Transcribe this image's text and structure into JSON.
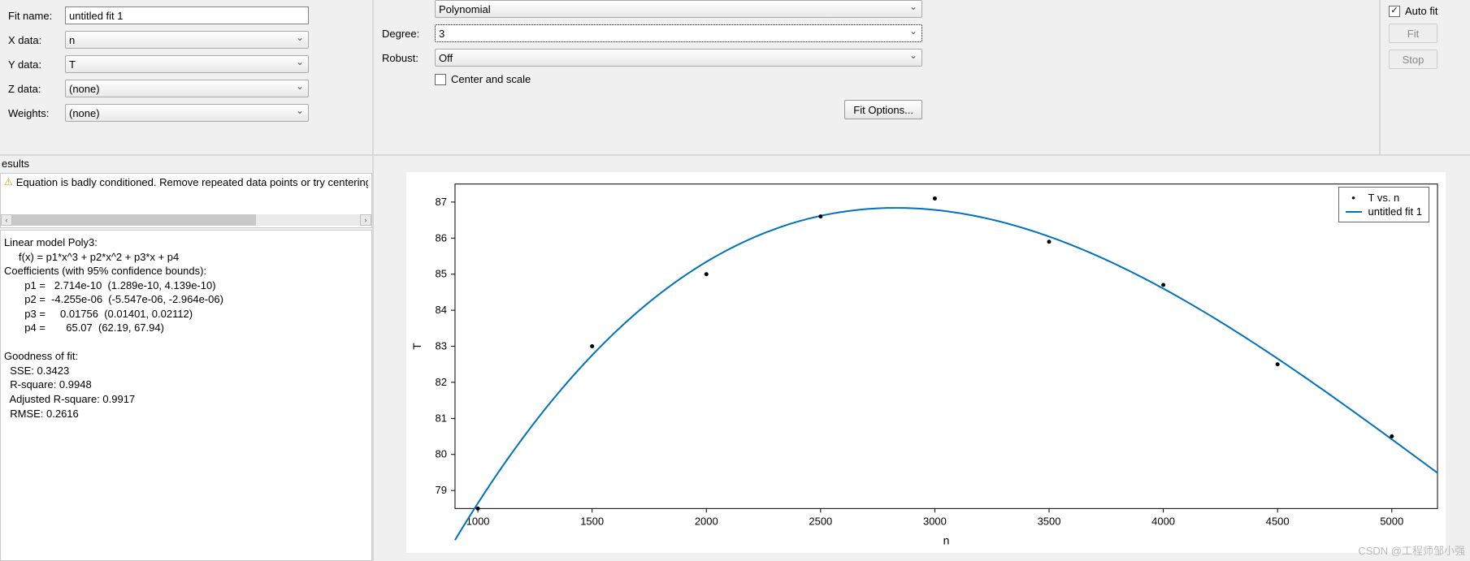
{
  "left": {
    "fit_name_label": "Fit name:",
    "fit_name_value": "untitled fit 1",
    "xdata_label": "X data:",
    "xdata_value": "n",
    "ydata_label": "Y data:",
    "ydata_value": "T",
    "zdata_label": "Z data:",
    "zdata_value": "(none)",
    "weights_label": "Weights:",
    "weights_value": "(none)"
  },
  "center": {
    "type_value": "Polynomial",
    "degree_label": "Degree:",
    "degree_value": "3",
    "robust_label": "Robust:",
    "robust_value": "Off",
    "center_scale_label": "Center and scale",
    "fit_options_label": "Fit Options..."
  },
  "right": {
    "autofit_label": "Auto fit",
    "fit_label": "Fit",
    "stop_label": "Stop"
  },
  "results": {
    "header": "esults",
    "warning": "Equation is badly conditioned. Remove repeated data points or try centering and scaling.",
    "model_text": "Linear model Poly3:\n     f(x) = p1*x^3 + p2*x^2 + p3*x + p4\nCoefficients (with 95% confidence bounds):\n       p1 =   2.714e-10  (1.289e-10, 4.139e-10)\n       p2 =  -4.255e-06  (-5.547e-06, -2.964e-06)\n       p3 =     0.01756  (0.01401, 0.02112)\n       p4 =       65.07  (62.19, 67.94)\n\nGoodness of fit:\n  SSE: 0.3423\n  R-square: 0.9948\n  Adjusted R-square: 0.9917\n  RMSE: 0.2616"
  },
  "legend": {
    "data_label": "T vs. n",
    "fit_label": "untitled fit 1"
  },
  "chart_data": {
    "type": "scatter",
    "xlabel": "n",
    "ylabel": "T",
    "xlim": [
      900,
      5200
    ],
    "ylim": [
      78.5,
      87.5
    ],
    "xticks": [
      1000,
      1500,
      2000,
      2500,
      3000,
      3500,
      4000,
      4500,
      5000
    ],
    "yticks": [
      79,
      80,
      81,
      82,
      83,
      84,
      85,
      86,
      87
    ],
    "series": [
      {
        "name": "T vs. n",
        "type": "scatter",
        "x": [
          1000,
          1500,
          2000,
          2500,
          3000,
          3500,
          4000,
          4500,
          5000
        ],
        "y": [
          78.5,
          83.0,
          85.0,
          86.6,
          87.1,
          85.9,
          84.7,
          82.5,
          80.5
        ]
      },
      {
        "name": "untitled fit 1",
        "type": "line",
        "equation": "2.714e-10*x^3 - 4.255e-06*x^2 + 0.01756*x + 65.07",
        "color": "#0072bd"
      }
    ]
  },
  "watermark": "CSDN @工程师邹小强"
}
